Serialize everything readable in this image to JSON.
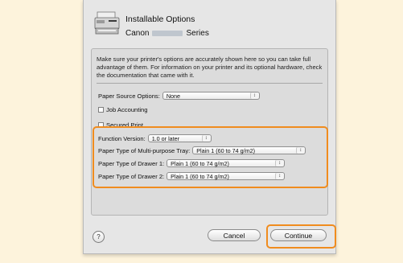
{
  "dialog": {
    "title": "Installable Options",
    "subtitle_prefix": "Canon",
    "subtitle_suffix": "Series",
    "intro": "Make sure your printer's options are accurately shown here so you can take full advantage of them.  For information on your printer and its optional hardware, check the documentation that came with it."
  },
  "options": {
    "paper_source": {
      "label": "Paper Source Options:",
      "value": "None"
    },
    "job_accounting": {
      "label": "Job Accounting",
      "checked": false
    },
    "secured_print": {
      "label": "Secured Print",
      "checked": false
    },
    "function_version": {
      "label": "Function Version:",
      "value": "1.0 or later"
    },
    "multi_purpose_tray": {
      "label": "Paper Type of Multi-purpose Tray:",
      "value": "Plain 1 (60 to 74 g/m2)"
    },
    "drawer_1": {
      "label": "Paper Type of Drawer 1:",
      "value": "Plain 1 (60 to 74 g/m2)"
    },
    "drawer_2": {
      "label": "Paper Type of Drawer 2:",
      "value": "Plain 1 (60 to 74 g/m2)"
    }
  },
  "footer": {
    "help": "?",
    "cancel": "Cancel",
    "continue": "Continue"
  },
  "colors": {
    "highlight": "#f08c1e",
    "page_background": "#fdf3dc"
  }
}
